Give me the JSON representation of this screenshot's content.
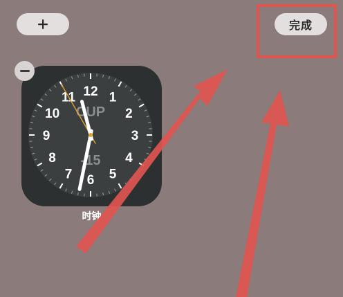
{
  "top_bar": {
    "add_label": "+",
    "done_label": "完成"
  },
  "widget": {
    "label": "时钟",
    "clock": {
      "city": "CUP",
      "offset": "-15",
      "numbers": [
        "12",
        "1",
        "2",
        "3",
        "4",
        "5",
        "6",
        "7",
        "8",
        "9",
        "10",
        "11"
      ],
      "time": {
        "hour": 11,
        "minute": 31,
        "second": 55
      }
    }
  },
  "icons": {
    "add": "plus-icon",
    "remove": "minus-icon"
  },
  "colors": {
    "background": "#8b7b7b",
    "pill": "#e4dfdf",
    "pill_text": "#2a2a2a",
    "widget_bg": "#2c3031",
    "clock_face": "#3b3f40",
    "hands": "#ffffff",
    "second_hand": "#e0a030",
    "city_text": "#8a8e8f",
    "annotation_red": "#e05550",
    "remove_badge": "#d9d4d3",
    "remove_bar": "#3a3a3a",
    "label_text": "#ffffff"
  }
}
